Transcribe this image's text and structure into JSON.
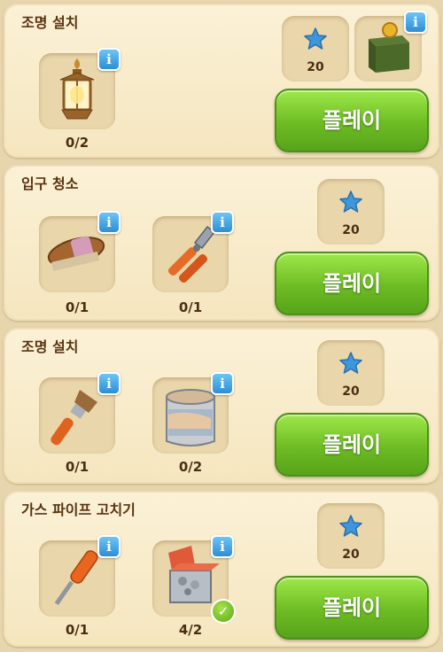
{
  "tasks": [
    {
      "title": "조명 설치",
      "items": [
        {
          "icon": "lantern-icon",
          "count": "0/2"
        }
      ],
      "reward": {
        "icon": "star-icon",
        "value": "20"
      },
      "bonus": {
        "icon": "green-box-icon"
      },
      "play_label": "플레이"
    },
    {
      "title": "입구 청소",
      "items": [
        {
          "icon": "scrub-brush-icon",
          "count": "0/1"
        },
        {
          "icon": "pliers-icon",
          "count": "0/1"
        }
      ],
      "reward": {
        "icon": "star-icon",
        "value": "20"
      },
      "play_label": "플레이"
    },
    {
      "title": "조명 설치",
      "items": [
        {
          "icon": "paintbrush-icon",
          "count": "0/1"
        },
        {
          "icon": "paint-can-icon",
          "count": "0/2"
        }
      ],
      "reward": {
        "icon": "star-icon",
        "value": "20"
      },
      "play_label": "플레이"
    },
    {
      "title": "가스 파이프 고치기",
      "items": [
        {
          "icon": "screwdriver-icon",
          "count": "0/1"
        },
        {
          "icon": "parts-box-icon",
          "count": "4/2",
          "complete": true
        }
      ],
      "reward": {
        "icon": "star-icon",
        "value": "20"
      },
      "play_label": "플레이"
    }
  ],
  "info_label": "i",
  "check_label": "✓",
  "colors": {
    "card": "#fbf1d6",
    "play_button": "#6dbc23",
    "info_badge": "#2b8ed6",
    "star": "#3d97dd",
    "title_text": "#5a3414"
  }
}
